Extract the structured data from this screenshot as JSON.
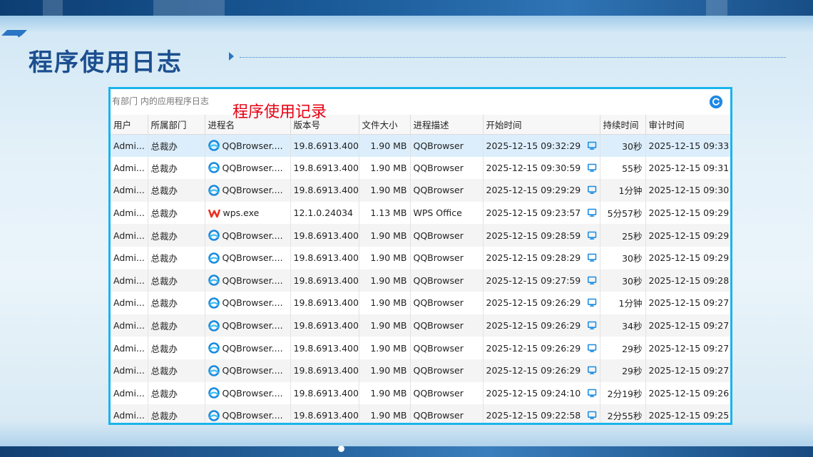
{
  "page": {
    "title": "程序使用日志"
  },
  "panel": {
    "hint": "有部门 内的应用程序日志",
    "overlay_label": "程序使用记录"
  },
  "columns": [
    "用户",
    "所属部门",
    "进程名",
    "版本号",
    "文件大小",
    "进程描述",
    "开始时间",
    "持续时间",
    "审计时间"
  ],
  "rows": [
    {
      "user": "Admi...",
      "dept": "总裁办",
      "proc": "QQBrowser....",
      "proc_icon": "qqbrowser-icon",
      "version": "19.8.6913.400",
      "size": "1.90 MB",
      "desc": "QQBrowser",
      "start": "2025-12-15 09:32:29",
      "duration": "30秒",
      "audit": "2025-12-15 09:33"
    },
    {
      "user": "Admi...",
      "dept": "总裁办",
      "proc": "QQBrowser....",
      "proc_icon": "qqbrowser-icon",
      "version": "19.8.6913.400",
      "size": "1.90 MB",
      "desc": "QQBrowser",
      "start": "2025-12-15 09:30:59",
      "duration": "55秒",
      "audit": "2025-12-15 09:31"
    },
    {
      "user": "Admi...",
      "dept": "总裁办",
      "proc": "QQBrowser....",
      "proc_icon": "qqbrowser-icon",
      "version": "19.8.6913.400",
      "size": "1.90 MB",
      "desc": "QQBrowser",
      "start": "2025-12-15 09:29:29",
      "duration": "1分钟",
      "audit": "2025-12-15 09:30"
    },
    {
      "user": "Admi...",
      "dept": "总裁办",
      "proc": "wps.exe",
      "proc_icon": "wps-icon",
      "version": "12.1.0.24034",
      "size": "1.13 MB",
      "desc": "WPS Office",
      "start": "2025-12-15 09:23:57",
      "duration": "5分57秒",
      "audit": "2025-12-15 09:29"
    },
    {
      "user": "Admi...",
      "dept": "总裁办",
      "proc": "QQBrowser....",
      "proc_icon": "qqbrowser-icon",
      "version": "19.8.6913.400",
      "size": "1.90 MB",
      "desc": "QQBrowser",
      "start": "2025-12-15 09:28:59",
      "duration": "25秒",
      "audit": "2025-12-15 09:29"
    },
    {
      "user": "Admi...",
      "dept": "总裁办",
      "proc": "QQBrowser....",
      "proc_icon": "qqbrowser-icon",
      "version": "19.8.6913.400",
      "size": "1.90 MB",
      "desc": "QQBrowser",
      "start": "2025-12-15 09:28:29",
      "duration": "30秒",
      "audit": "2025-12-15 09:29"
    },
    {
      "user": "Admi...",
      "dept": "总裁办",
      "proc": "QQBrowser....",
      "proc_icon": "qqbrowser-icon",
      "version": "19.8.6913.400",
      "size": "1.90 MB",
      "desc": "QQBrowser",
      "start": "2025-12-15 09:27:59",
      "duration": "30秒",
      "audit": "2025-12-15 09:28"
    },
    {
      "user": "Admi...",
      "dept": "总裁办",
      "proc": "QQBrowser....",
      "proc_icon": "qqbrowser-icon",
      "version": "19.8.6913.400",
      "size": "1.90 MB",
      "desc": "QQBrowser",
      "start": "2025-12-15 09:26:29",
      "duration": "1分钟",
      "audit": "2025-12-15 09:27"
    },
    {
      "user": "Admi...",
      "dept": "总裁办",
      "proc": "QQBrowser....",
      "proc_icon": "qqbrowser-icon",
      "version": "19.8.6913.400",
      "size": "1.90 MB",
      "desc": "QQBrowser",
      "start": "2025-12-15 09:26:29",
      "duration": "34秒",
      "audit": "2025-12-15 09:27"
    },
    {
      "user": "Admi...",
      "dept": "总裁办",
      "proc": "QQBrowser....",
      "proc_icon": "qqbrowser-icon",
      "version": "19.8.6913.400",
      "size": "1.90 MB",
      "desc": "QQBrowser",
      "start": "2025-12-15 09:26:29",
      "duration": "29秒",
      "audit": "2025-12-15 09:27"
    },
    {
      "user": "Admi...",
      "dept": "总裁办",
      "proc": "QQBrowser....",
      "proc_icon": "qqbrowser-icon",
      "version": "19.8.6913.400",
      "size": "1.90 MB",
      "desc": "QQBrowser",
      "start": "2025-12-15 09:26:29",
      "duration": "29秒",
      "audit": "2025-12-15 09:27"
    },
    {
      "user": "Admi...",
      "dept": "总裁办",
      "proc": "QQBrowser....",
      "proc_icon": "qqbrowser-icon",
      "version": "19.8.6913.400",
      "size": "1.90 MB",
      "desc": "QQBrowser",
      "start": "2025-12-15 09:24:10",
      "duration": "2分19秒",
      "audit": "2025-12-15 09:26"
    },
    {
      "user": "Admi...",
      "dept": "总裁办",
      "proc": "QQBrowser....",
      "proc_icon": "qqbrowser-icon",
      "version": "19.8.6913.400",
      "size": "1.90 MB",
      "desc": "QQBrowser",
      "start": "2025-12-15 09:22:58",
      "duration": "2分55秒",
      "audit": "2025-12-15 09:25"
    }
  ],
  "colors": {
    "accent": "#19b4ec",
    "title": "#1c4f8f",
    "overlay": "#e60012",
    "selected_row": "#dceefc"
  }
}
